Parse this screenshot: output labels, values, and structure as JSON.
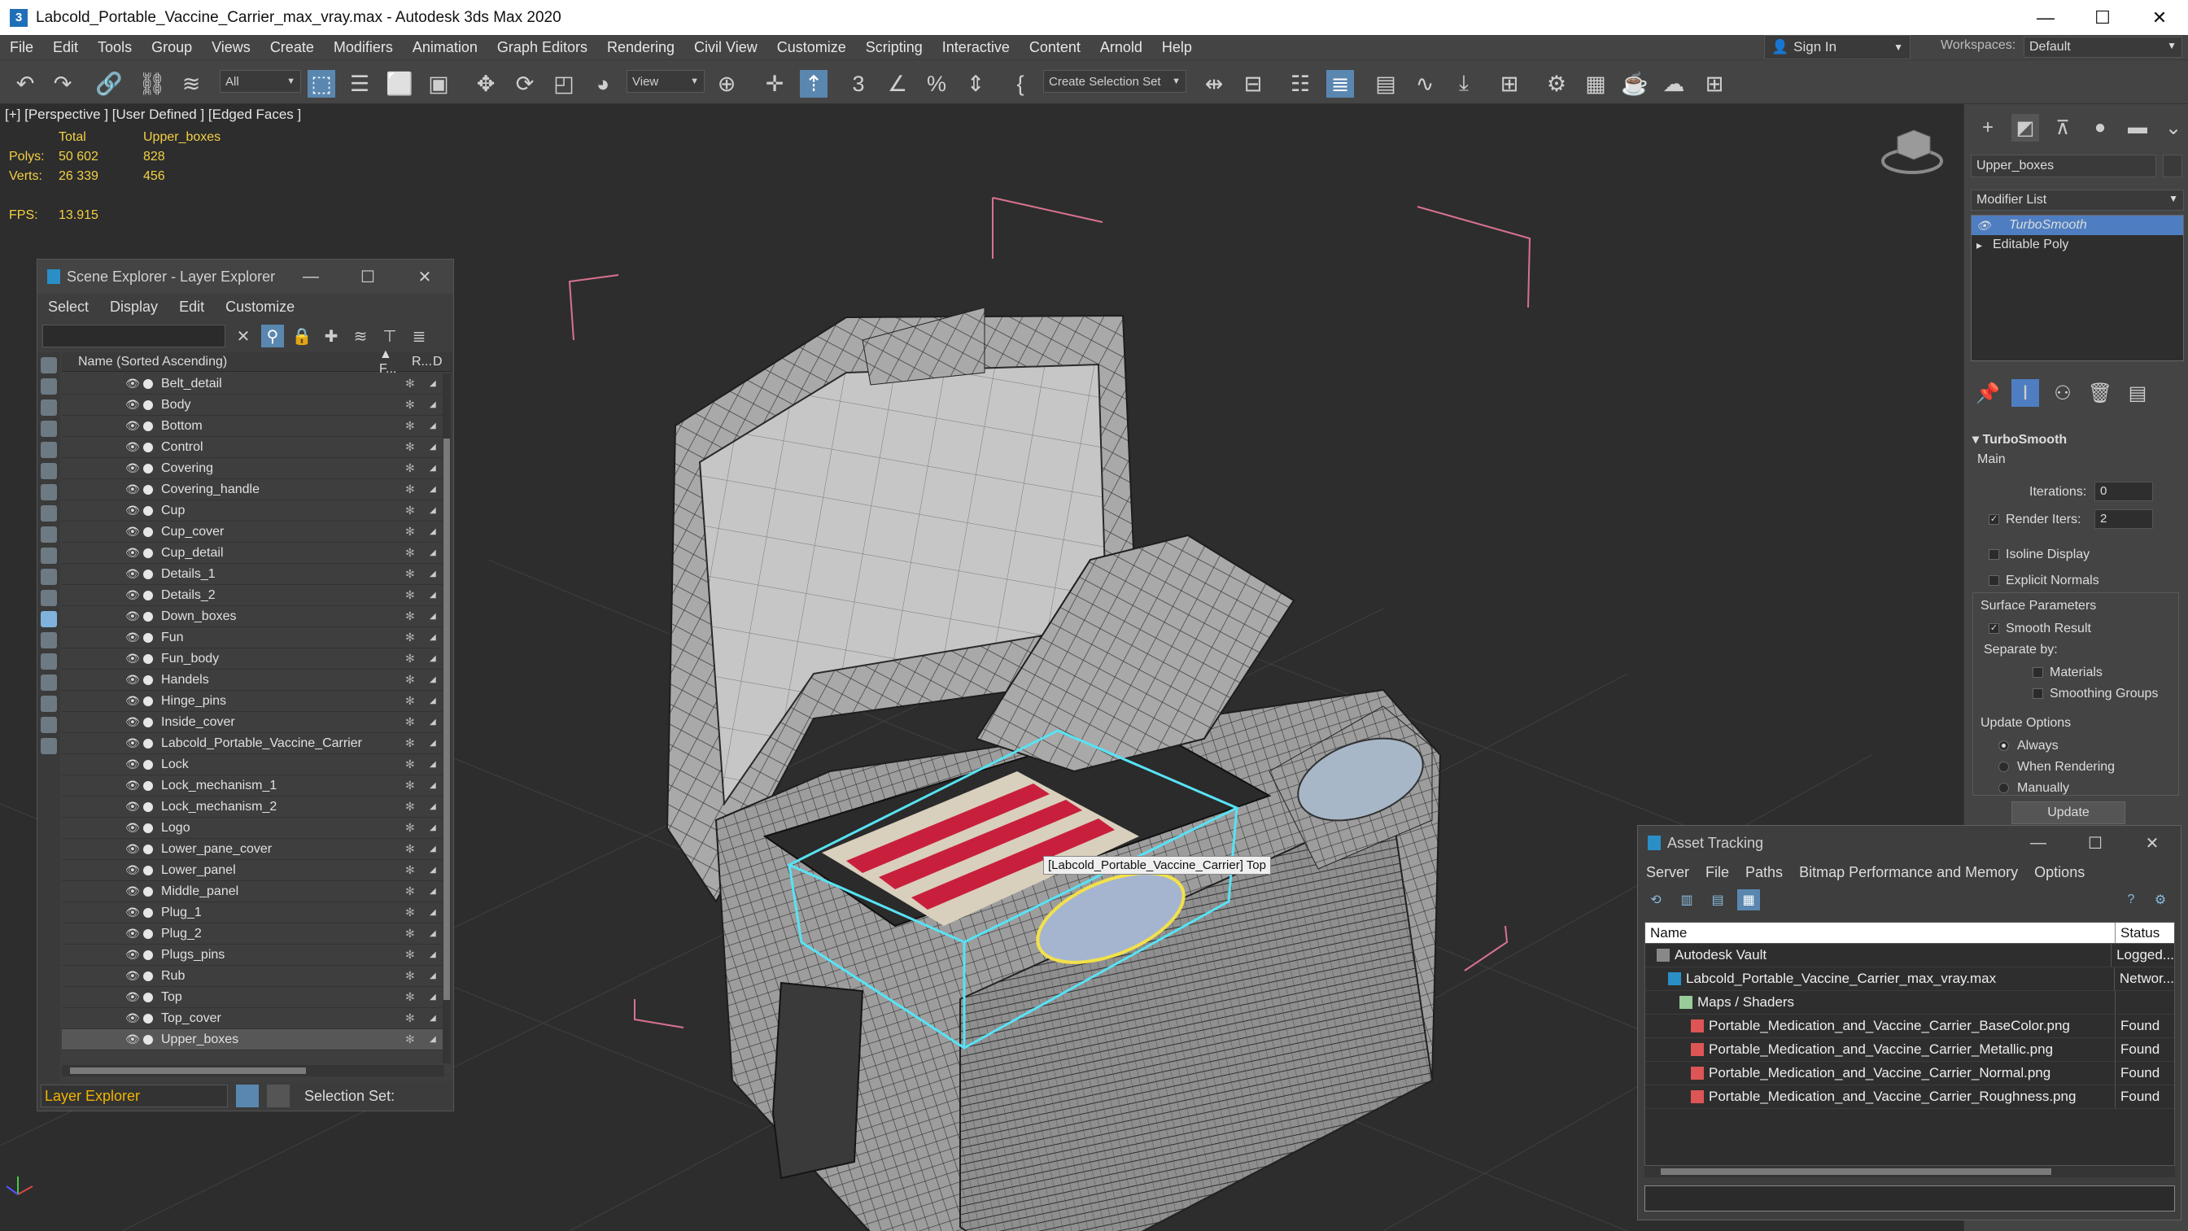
{
  "window": {
    "title": "Labcold_Portable_Vaccine_Carrier_max_vray.max - Autodesk 3ds Max 2020",
    "app_icon": "3",
    "controls": [
      "—",
      "☐",
      "✕"
    ]
  },
  "menubar": [
    "File",
    "Edit",
    "Tools",
    "Group",
    "Views",
    "Create",
    "Modifiers",
    "Animation",
    "Graph Editors",
    "Rendering",
    "Civil View",
    "Customize",
    "Scripting",
    "Interactive",
    "Content",
    "Arnold",
    "Help"
  ],
  "account": {
    "sign_in": "Sign In",
    "workspaces_label": "Workspaces:",
    "workspace": "Default"
  },
  "toolbar": {
    "filter_select": "All",
    "view_select": "View",
    "selection_set": "Create Selection Set",
    "icons": [
      "undo-icon",
      "redo-icon",
      "link-icon",
      "unlink-icon",
      "bind-space-warp-icon",
      "select-object-icon",
      "select-by-name-icon",
      "rect-region-icon",
      "window-crossing-icon",
      "move-icon",
      "rotate-icon",
      "scale-icon",
      "place-icon",
      "pivot-icon",
      "select-manipulate-icon",
      "snap-3d-icon",
      "angle-snap-icon",
      "percent-snap-icon",
      "spinner-snap-icon",
      "named-sets-icon",
      "mirror-icon",
      "align-icon",
      "layer-explorer-icon",
      "scene-explorer-icon",
      "ribbon-icon",
      "curve-editor-icon",
      "schematic-icon",
      "material-editor-icon",
      "render-setup-icon",
      "render-frame-icon",
      "render-icon",
      "render-online-icon",
      "render-iterative-icon",
      "grid-icon"
    ]
  },
  "viewport": {
    "label": "[+] [Perspective ] [User Defined ] [Edged Faces ]",
    "stats": {
      "col1": "Total",
      "col2": "Upper_boxes",
      "polys_label": "Polys:",
      "polys_total": "50 602",
      "polys_sel": "828",
      "verts_label": "Verts:",
      "verts_total": "26 339",
      "verts_sel": "456",
      "fps_label": "FPS:",
      "fps": "13.915"
    },
    "tooltip": "[Labcold_Portable_Vaccine_Carrier] Top"
  },
  "scene_explorer": {
    "title": "Scene Explorer - Layer Explorer",
    "menu": [
      "Select",
      "Display",
      "Edit",
      "Customize"
    ],
    "column_name": "Name (Sorted Ascending)",
    "col_f": "▲ F...",
    "col_r": "R...",
    "col_d": "D",
    "items": [
      "Belt_detail",
      "Body",
      "Bottom",
      "Control",
      "Covering",
      "Covering_handle",
      "Cup",
      "Cup_cover",
      "Cup_detail",
      "Details_1",
      "Details_2",
      "Down_boxes",
      "Fun",
      "Fun_body",
      "Handels",
      "Hinge_pins",
      "Inside_cover",
      "Labcold_Portable_Vaccine_Carrier",
      "Lock",
      "Lock_mechanism_1",
      "Lock_mechanism_2",
      "Logo",
      "Lower_pane_cover",
      "Lower_panel",
      "Middle_panel",
      "Plug_1",
      "Plug_2",
      "Plugs_pins",
      "Rub",
      "Top",
      "Top_cover",
      "Upper_boxes"
    ],
    "selected": "Upper_boxes",
    "footer_select": "Layer Explorer",
    "selection_set_label": "Selection Set:"
  },
  "command_panel": {
    "object_name": "Upper_boxes",
    "modifier_list": "Modifier List",
    "stack": [
      "TurboSmooth",
      "Editable Poly"
    ],
    "rollout_title": "TurboSmooth",
    "main": "Main",
    "iterations_label": "Iterations:",
    "iterations": "0",
    "render_iters_label": "Render Iters:",
    "render_iters": "2",
    "isoline": "Isoline Display",
    "explicit_normals": "Explicit Normals",
    "surface_params": "Surface Parameters",
    "smooth_result": "Smooth Result",
    "separate_by": "Separate by:",
    "materials": "Materials",
    "smoothing_groups": "Smoothing Groups",
    "update_options": "Update Options",
    "always": "Always",
    "when_rendering": "When Rendering",
    "manually": "Manually",
    "update_button": "Update"
  },
  "asset_tracking": {
    "title": "Asset Tracking",
    "menu": [
      "Server",
      "File",
      "Paths",
      "Bitmap Performance and Memory",
      "Options"
    ],
    "col_name": "Name",
    "col_status": "Status",
    "rows": [
      {
        "name": "Autodesk Vault",
        "status": "Logged..."
      },
      {
        "name": "Labcold_Portable_Vaccine_Carrier_max_vray.max",
        "status": "Networ..."
      },
      {
        "name": "Maps / Shaders",
        "status": ""
      },
      {
        "name": "Portable_Medication_and_Vaccine_Carrier_BaseColor.png",
        "status": "Found"
      },
      {
        "name": "Portable_Medication_and_Vaccine_Carrier_Metallic.png",
        "status": "Found"
      },
      {
        "name": "Portable_Medication_and_Vaccine_Carrier_Normal.png",
        "status": "Found"
      },
      {
        "name": "Portable_Medication_and_Vaccine_Carrier_Roughness.png",
        "status": "Found"
      }
    ]
  },
  "colors": {
    "accent": "#5a87b0",
    "stats": "#f2d044",
    "selection_cyan": "#57e3f5",
    "selection_yellow": "#f2e14a",
    "modifier_selected": "#4e7ec1",
    "layer_explorer_text": "#f2b400"
  }
}
